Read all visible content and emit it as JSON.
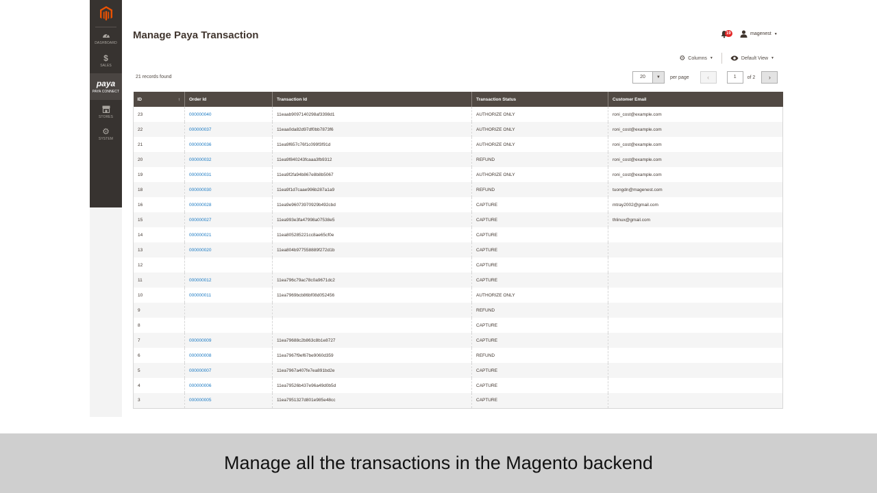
{
  "sidebar": {
    "items": [
      {
        "label": "DASHBOARD",
        "icon": "dashboard-icon"
      },
      {
        "label": "SALES",
        "icon": "dollar-icon"
      },
      {
        "label": "PAYA CONNECT",
        "icon": "paya-logo",
        "logo_text": "paya"
      },
      {
        "label": "STORES",
        "icon": "store-icon"
      },
      {
        "label": "SYSTEM",
        "icon": "gear-icon"
      }
    ]
  },
  "header": {
    "title": "Manage Paya Transaction",
    "notifications": "19",
    "user": "magenest"
  },
  "toolbar": {
    "columns_label": "Columns",
    "view_label": "Default View"
  },
  "grid_info": {
    "records": "21 records found",
    "per_page_value": "20",
    "per_page_label": "per page",
    "current_page": "1",
    "total_pages_label": "of 2"
  },
  "table": {
    "headers": [
      "ID",
      "Order Id",
      "Transaction Id",
      "Transaction Status",
      "Customer Email"
    ],
    "rows": [
      [
        "23",
        "000000040",
        "11eaab9097140298af3398d1",
        "AUTHORIZE ONLY",
        "roni_cost@example.com"
      ],
      [
        "22",
        "000000037",
        "11eaa0da82d97df0bb7873f6",
        "AUTHORIZE ONLY",
        "roni_cost@example.com"
      ],
      [
        "21",
        "000000036",
        "11ea9f657c76f1c099f3f91d",
        "AUTHORIZE ONLY",
        "roni_cost@example.com"
      ],
      [
        "20",
        "000000032",
        "11ea9f840243fcaaa3fb9312",
        "REFUND",
        "roni_cost@example.com"
      ],
      [
        "19",
        "000000031",
        "11ea9f2fa94b867e8b8b5067",
        "AUTHORIZE ONLY",
        "roni_cost@example.com"
      ],
      [
        "18",
        "000000030",
        "11ea9f1d7caae996b287a1a9",
        "REFUND",
        "tuongdn@magenest.com"
      ],
      [
        "16",
        "000000028",
        "11ea9e96073970929b492cbd",
        "CAPTURE",
        "mtray2002@gmail.com"
      ],
      [
        "15",
        "000000027",
        "11ea993e3fa47998a07538e5",
        "CAPTURE",
        "thlinux@gmail.com"
      ],
      [
        "14",
        "000000021",
        "11ea805285221cc8ae65cf0e",
        "CAPTURE",
        ""
      ],
      [
        "13",
        "000000020",
        "11ea804b977558889f272d1b",
        "CAPTURE",
        ""
      ],
      [
        "12",
        "",
        "",
        "CAPTURE",
        ""
      ],
      [
        "11",
        "000000012",
        "11ea796c79ac78c0a9671dc2",
        "CAPTURE",
        ""
      ],
      [
        "10",
        "000000011",
        "11ea7969bcb86bf08d052456",
        "AUTHORIZE ONLY",
        ""
      ],
      [
        "9",
        "",
        "",
        "REFUND",
        ""
      ],
      [
        "8",
        "",
        "",
        "CAPTURE",
        ""
      ],
      [
        "7",
        "000000009",
        "11ea79688c2b863c8b1e8727",
        "CAPTURE",
        ""
      ],
      [
        "6",
        "000000008",
        "11ea7967f9ef67be9060d359",
        "REFUND",
        ""
      ],
      [
        "5",
        "000000007",
        "11ea7967a407fe7ea891bd2e",
        "CAPTURE",
        ""
      ],
      [
        "4",
        "000000006",
        "11ea79526b437e96a49d0b5d",
        "CAPTURE",
        ""
      ],
      [
        "3",
        "000000005",
        "11ea7951327d801e985e48cc",
        "CAPTURE",
        ""
      ]
    ]
  },
  "caption": "Manage all the transactions in the Magento backend",
  "colors": {
    "sidebar": "#373330",
    "table_header": "#514943",
    "link": "#1979c3",
    "badge": "#e22626",
    "magento_orange": "#eb5202"
  }
}
